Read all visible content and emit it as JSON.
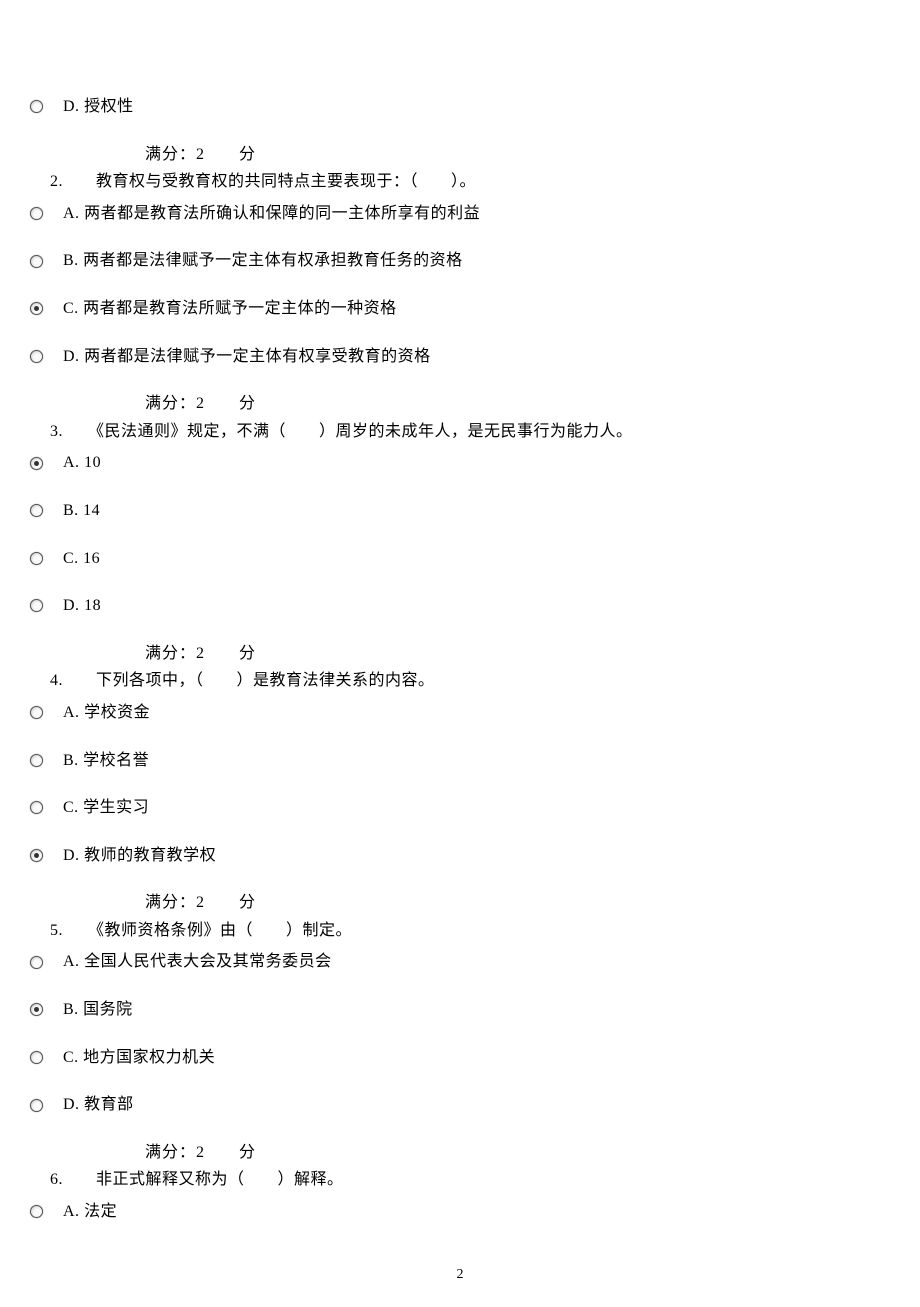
{
  "score_label": "满分：2",
  "score_suffix": "分",
  "page_number": "2",
  "pre_option": {
    "label": "D.",
    "text": "授权性"
  },
  "questions": [
    {
      "number": "2.",
      "stem": "教育权与受教育权的共同特点主要表现于：（　　）。",
      "options": [
        {
          "label": "A.",
          "text": "两者都是教育法所确认和保障的同一主体所享有的利益",
          "selected": false
        },
        {
          "label": "B.",
          "text": "两者都是法律赋予一定主体有权承担教育任务的资格",
          "selected": false
        },
        {
          "label": "C.",
          "text": "两者都是教育法所赋予一定主体的一种资格",
          "selected": true
        },
        {
          "label": "D.",
          "text": "两者都是法律赋予一定主体有权享受教育的资格",
          "selected": false
        }
      ]
    },
    {
      "number": "3.",
      "stem": "《民法通则》规定，不满（　　）周岁的未成年人，是无民事行为能力人。",
      "options": [
        {
          "label": "A.",
          "text": "10",
          "selected": true
        },
        {
          "label": "B.",
          "text": "14",
          "selected": false
        },
        {
          "label": "C.",
          "text": "16",
          "selected": false
        },
        {
          "label": "D.",
          "text": "18",
          "selected": false
        }
      ]
    },
    {
      "number": "4.",
      "stem": "下列各项中，（　　）是教育法律关系的内容。",
      "options": [
        {
          "label": "A.",
          "text": "学校资金",
          "selected": false
        },
        {
          "label": "B.",
          "text": "学校名誉",
          "selected": false
        },
        {
          "label": "C.",
          "text": "学生实习",
          "selected": false
        },
        {
          "label": "D.",
          "text": "教师的教育教学权",
          "selected": true
        }
      ]
    },
    {
      "number": "5.",
      "stem": "《教师资格条例》由（　　）制定。",
      "options": [
        {
          "label": "A.",
          "text": "全国人民代表大会及其常务委员会",
          "selected": false
        },
        {
          "label": "B.",
          "text": "国务院",
          "selected": true
        },
        {
          "label": "C.",
          "text": "地方国家权力机关",
          "selected": false
        },
        {
          "label": "D.",
          "text": "教育部",
          "selected": false
        }
      ]
    },
    {
      "number": "6.",
      "stem": "非正式解释又称为（　　）解释。",
      "options": [
        {
          "label": "A.",
          "text": "法定",
          "selected": false
        }
      ],
      "no_score": true
    }
  ]
}
